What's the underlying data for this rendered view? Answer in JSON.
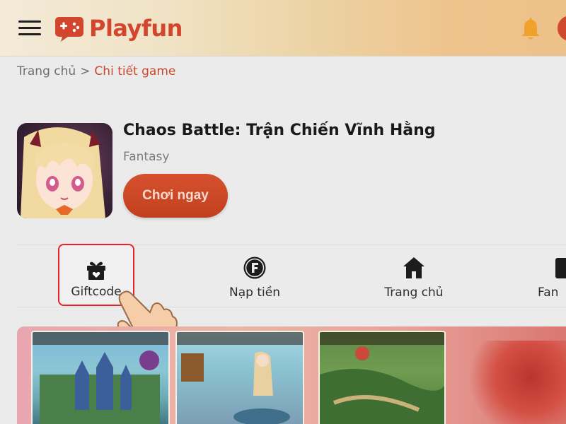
{
  "header": {
    "logo_text": "Playfun",
    "menu_icon": "hamburger-menu-icon",
    "bell_icon": "bell-icon"
  },
  "breadcrumb": {
    "home": "Trang chủ",
    "separator": ">",
    "current": "Chi tiết game"
  },
  "game": {
    "title": "Chaos Battle: Trận Chiến Vĩnh Hằng",
    "genre": "Fantasy",
    "play_label": "Chơi ngay"
  },
  "actions": [
    {
      "label": "Giftcode",
      "icon": "gift-icon",
      "highlighted": true
    },
    {
      "label": "Nạp tiền",
      "icon": "coin-f-icon"
    },
    {
      "label": "Trang chủ",
      "icon": "home-icon"
    },
    {
      "label": "Fan",
      "icon": "fanpage-icon"
    }
  ],
  "colors": {
    "brand": "#d2462d",
    "play_button": "#c9482a",
    "highlight_border": "#e8222a"
  }
}
